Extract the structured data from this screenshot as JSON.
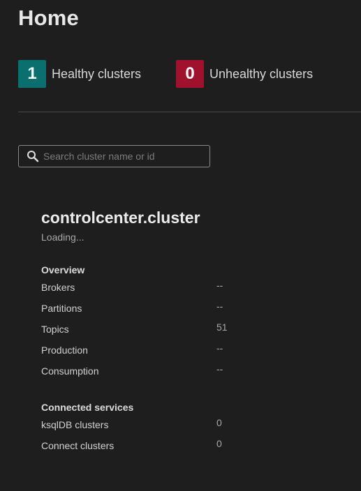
{
  "page_title": "Home",
  "stats": {
    "healthy": {
      "count": "1",
      "label": "Healthy clusters",
      "color": "#0b6e6f"
    },
    "unhealthy": {
      "count": "0",
      "label": "Unhealthy clusters",
      "color": "#a0112d"
    }
  },
  "search": {
    "placeholder": "Search cluster name or id",
    "value": "",
    "icon": "search-icon"
  },
  "cluster": {
    "name": "controlcenter.cluster",
    "status": "Loading...",
    "overview": {
      "heading": "Overview",
      "rows": [
        {
          "label": "Brokers",
          "value": "--"
        },
        {
          "label": "Partitions",
          "value": "--"
        },
        {
          "label": "Topics",
          "value": "51"
        },
        {
          "label": "Production",
          "value": "--"
        },
        {
          "label": "Consumption",
          "value": "--"
        }
      ]
    },
    "connected_services": {
      "heading": "Connected services",
      "rows": [
        {
          "label": "ksqlDB clusters",
          "value": "0"
        },
        {
          "label": "Connect clusters",
          "value": "0"
        }
      ]
    }
  }
}
